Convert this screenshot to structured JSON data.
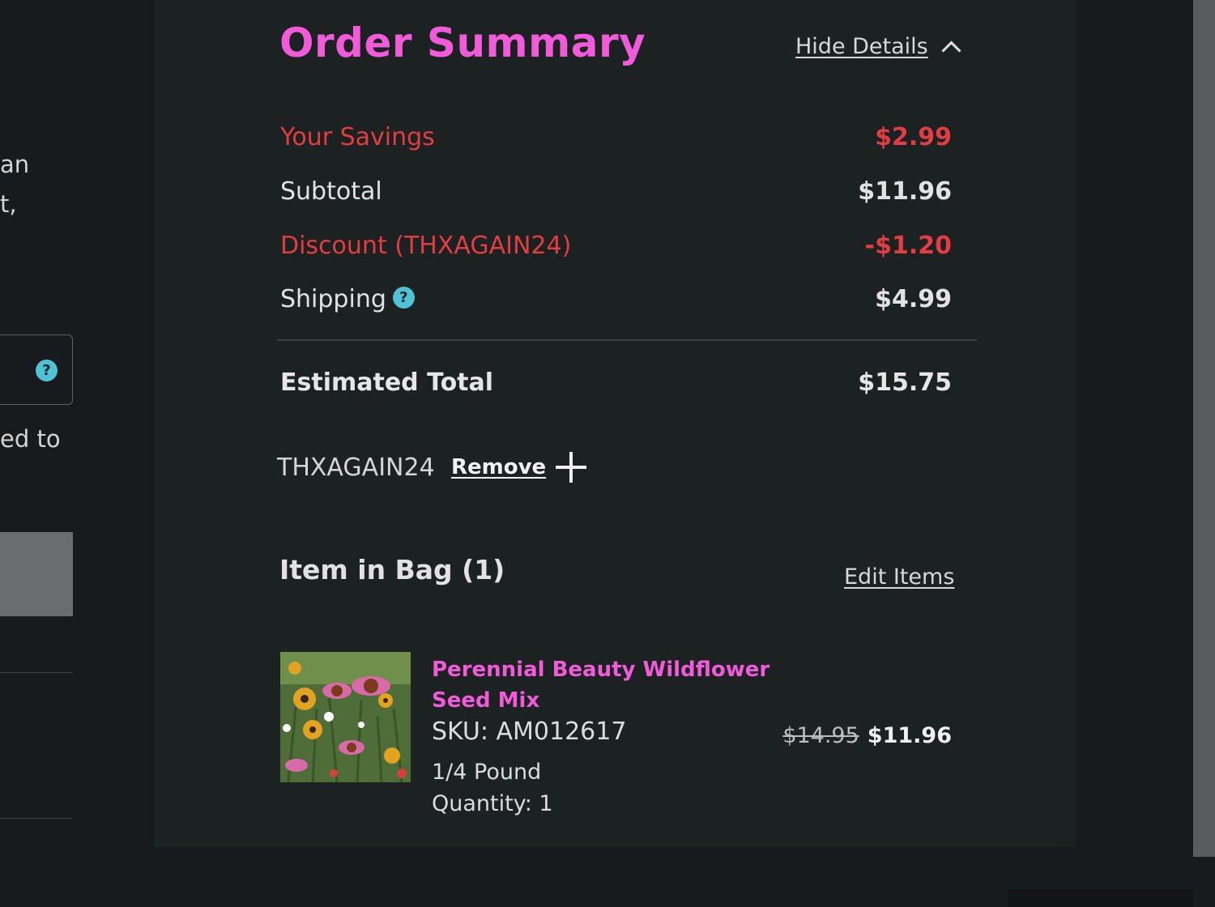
{
  "left": {
    "text_line1": "an",
    "text_line2": "t,",
    "text_line3": "ed to",
    "help_glyph": "?"
  },
  "summary": {
    "title": "Order Summary",
    "hide_details": "Hide Details",
    "savings_label": "Your Savings",
    "savings_value": "$2.99",
    "subtotal_label": "Subtotal",
    "subtotal_value": "$11.96",
    "discount_label": "Discount (THXAGAIN24)",
    "discount_value": "-$1.20",
    "shipping_label": "Shipping",
    "shipping_value": "$4.99",
    "total_label": "Estimated Total",
    "total_value": "$15.75",
    "help_glyph": "?"
  },
  "promo": {
    "code": "THXAGAIN24",
    "remove_label": "Remove"
  },
  "bag": {
    "title": "Item in Bag (1)",
    "edit_label": "Edit Items",
    "item": {
      "name": "Perennial Beauty Wildflower Seed Mix",
      "sku": "SKU: AM012617",
      "size": "1/4 Pound",
      "quantity": "Quantity: 1",
      "original_price": "$14.95",
      "price": "$11.96"
    }
  },
  "colors": {
    "accent_pink": "#f15bd9",
    "savings_red": "#e33c42",
    "help_teal": "#4fc3d1",
    "panel_bg": "#1c2122",
    "page_bg": "#181b1d"
  },
  "icons": [
    "help-circle-icon",
    "chevron-up-icon",
    "plus-icon"
  ]
}
